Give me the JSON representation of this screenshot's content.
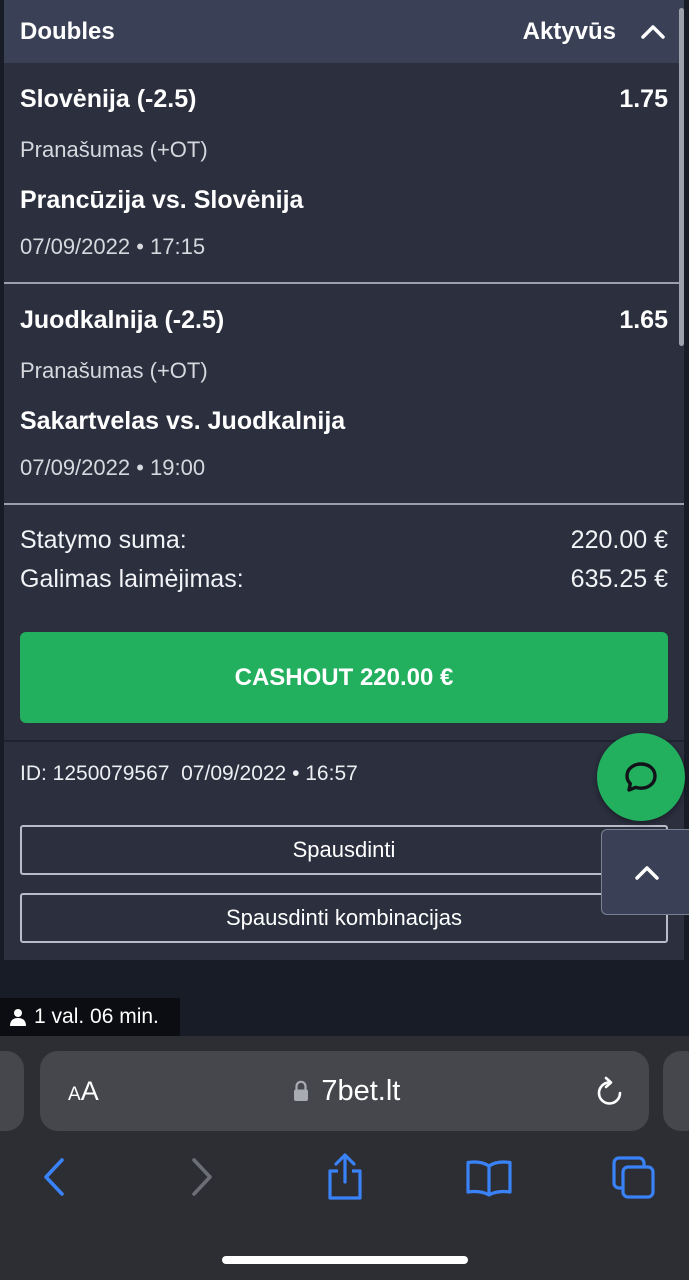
{
  "header": {
    "title": "Doubles",
    "status": "Aktyvūs"
  },
  "selections": [
    {
      "pick": "Slovėnija (-2.5)",
      "odds": "1.75",
      "market": "Pranašumas (+OT)",
      "match": "Prancūzija vs. Slovėnija",
      "datetime": "07/09/2022 • 17:15"
    },
    {
      "pick": "Juodkalnija (-2.5)",
      "odds": "1.65",
      "market": "Pranašumas (+OT)",
      "match": "Sakartvelas vs. Juodkalnija",
      "datetime": "07/09/2022 • 19:00"
    }
  ],
  "summary": {
    "stake_label": "Statymo suma:",
    "stake_value": "220.00 €",
    "win_label": "Galimas laimėjimas:",
    "win_value": "635.25 €"
  },
  "cashout_label": "CASHOUT 220.00 €",
  "bet_info": "ID: 1250079567  07/09/2022 • 16:57",
  "buttons": {
    "print": "Spausdinti",
    "print_combinations": "Spausdinti kombinacijas"
  },
  "session_timer": "1 val. 06 min.",
  "browser": {
    "aa_small": "A",
    "aa_large": "A",
    "url": "7bet.lt"
  },
  "icons": [
    "chevron-up-icon",
    "chat-icon",
    "user-icon",
    "lock-icon",
    "reload-icon",
    "back-icon",
    "forward-icon",
    "share-icon",
    "bookmarks-icon",
    "tabs-icon"
  ],
  "colors": {
    "accent_green": "#22af5e",
    "card_bg": "#2b2f3e",
    "header_bg": "#3a4156",
    "safari_blue": "#3a82f7"
  }
}
